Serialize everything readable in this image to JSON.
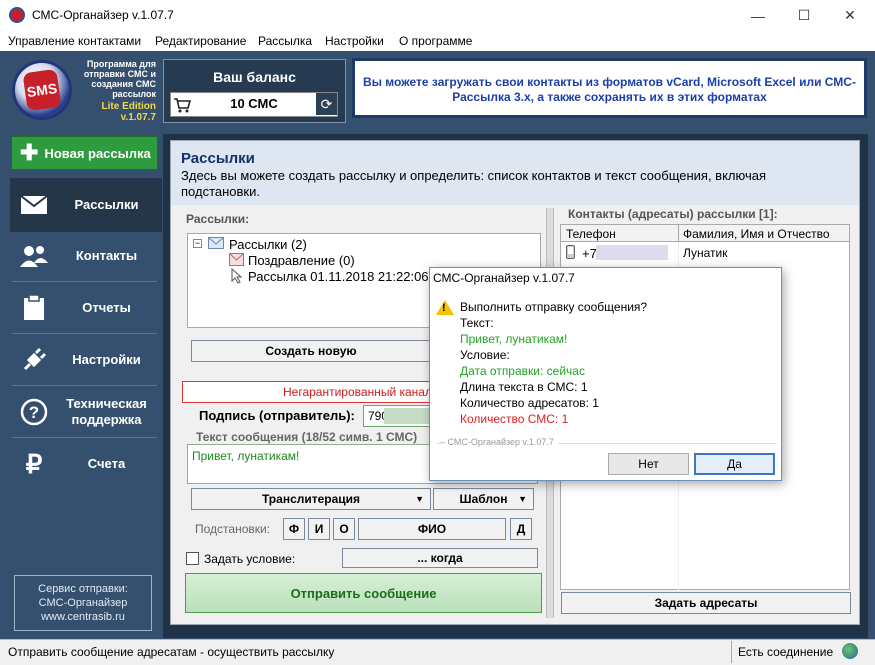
{
  "window": {
    "title": "СМС-Органайзер v.1.07.7",
    "controls": {
      "minimize": "—",
      "maximize": "☐",
      "close": "✕"
    }
  },
  "menu": [
    "Управление контактами",
    "Редактирование",
    "Рассылка",
    "Настройки",
    "О программе"
  ],
  "logo": {
    "mark": "SMS",
    "caption": "Программа для отправки СМС и создания СМС рассылок",
    "edition": "Lite Edition",
    "version": "v.1.07.7"
  },
  "sidebar": {
    "new_button": "Новая рассылка",
    "items": [
      {
        "label": "Рассылки",
        "icon": "envelope-icon"
      },
      {
        "label": "Контакты",
        "icon": "people-icon"
      },
      {
        "label": "Отчеты",
        "icon": "clipboard-icon"
      },
      {
        "label": "Настройки",
        "icon": "plug-icon"
      },
      {
        "label": "Техническая поддержка",
        "icon": "question-icon"
      },
      {
        "label": "Счета",
        "icon": "ruble-icon"
      }
    ],
    "service": {
      "line1": "Сервис отправки:",
      "line2": "СМС-Органайзер",
      "line3": "www.centrasib.ru"
    }
  },
  "balance": {
    "title": "Ваш баланс",
    "value": "10 СМС"
  },
  "banner": "Вы можете загружать свои контакты из форматов vCard, Microsoft Excel или СМС-Рассылка 3.x, а также сохранять их в этих форматах",
  "section": {
    "title": "Рассылки",
    "description": "Здесь вы можете создать рассылку и определить: список контактов и текст сообщения, включая подстановки."
  },
  "mailings": {
    "group_label": "Рассылки:",
    "tree": {
      "root": "Рассылки (2)",
      "child1": "Поздравление (0)",
      "child2": "Рассылка 01.11.2018 21:22:06"
    },
    "create_button": "Создать новую"
  },
  "form": {
    "warning": "Негарантированный канал",
    "signature_label": "Подпись (отправитель):",
    "signature_value": "790",
    "message_label": "Текст сообщения (18/52 симв. 1 СМС)",
    "message_value": "Привет, лунатикам!",
    "translit": "Транслитерация",
    "template": "Шаблон",
    "subst_label": "Подстановки:",
    "subst": {
      "f": "Ф",
      "i": "И",
      "o": "О",
      "fio": "ФИО",
      "d": "Д"
    },
    "condition_label": "Задать условие:",
    "condition_button": "... когда",
    "send_button": "Отправить сообщение"
  },
  "contacts": {
    "group_label": "Контакты (адресаты) рассылки [1]:",
    "columns": [
      "Телефон",
      "Фамилия, Имя и Отчество"
    ],
    "rows": [
      {
        "phone": "+7",
        "name": "Лунатик"
      }
    ],
    "set_button": "Задать адресаты"
  },
  "statusbar": {
    "text": "Отправить сообщение адресатам - осуществить рассылку",
    "connection": "Есть соединение"
  },
  "dialog": {
    "title": "СМС-Органайзер v.1.07.7",
    "question": "Выполнить отправку сообщения?",
    "text_label": "Текст:",
    "text_value": "Привет, лунатикам!",
    "condition_label": "Условие:",
    "condition_value": "Дата отправки: сейчас",
    "length": "Длина текста в СМС: 1",
    "recipients": "Количество адресатов: 1",
    "sms_count": "Количество СМС: 1",
    "footer": "– СМС-Органайзер v.1.07.7",
    "no": "Нет",
    "yes": "Да"
  }
}
